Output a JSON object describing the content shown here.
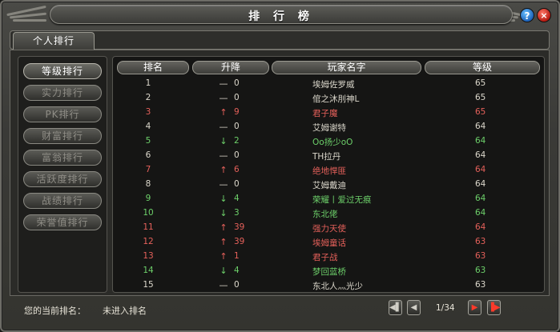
{
  "window": {
    "title": "排 行 榜",
    "help_label": "?",
    "close_label": "×"
  },
  "tab": {
    "label": "个人排行"
  },
  "sidebar": {
    "items": [
      {
        "label": "等级排行",
        "active": true
      },
      {
        "label": "实力排行",
        "active": false
      },
      {
        "label": "PK排行",
        "active": false
      },
      {
        "label": "财富排行",
        "active": false
      },
      {
        "label": "富翁排行",
        "active": false
      },
      {
        "label": "活跃度排行",
        "active": false
      },
      {
        "label": "战绩排行",
        "active": false
      },
      {
        "label": "荣誉值排行",
        "active": false
      }
    ]
  },
  "table": {
    "headers": {
      "rank": "排名",
      "change": "升降",
      "name": "玩家名字",
      "level": "等级"
    },
    "rows": [
      {
        "rank": "1",
        "dir": "flat",
        "delta": "0",
        "name": "埃姆佐罗威",
        "level": "65",
        "color": "white"
      },
      {
        "rank": "2",
        "dir": "flat",
        "delta": "0",
        "name": "倌之沐刖神L",
        "level": "65",
        "color": "white"
      },
      {
        "rank": "3",
        "dir": "up",
        "delta": "9",
        "name": "君子魔",
        "level": "65",
        "color": "red"
      },
      {
        "rank": "4",
        "dir": "flat",
        "delta": "0",
        "name": "艾姆谢特",
        "level": "64",
        "color": "white"
      },
      {
        "rank": "5",
        "dir": "down",
        "delta": "2",
        "name": "Oo扬少oO",
        "level": "64",
        "color": "green"
      },
      {
        "rank": "6",
        "dir": "flat",
        "delta": "0",
        "name": "TH拉丹",
        "level": "64",
        "color": "white"
      },
      {
        "rank": "7",
        "dir": "up",
        "delta": "6",
        "name": "绝地悍匪",
        "level": "64",
        "color": "red"
      },
      {
        "rank": "8",
        "dir": "flat",
        "delta": "0",
        "name": "艾姆戴迪",
        "level": "64",
        "color": "white"
      },
      {
        "rank": "9",
        "dir": "down",
        "delta": "4",
        "name": "荣耀丨爱过无痕",
        "level": "64",
        "color": "green"
      },
      {
        "rank": "10",
        "dir": "down",
        "delta": "3",
        "name": "东北佬",
        "level": "64",
        "color": "green"
      },
      {
        "rank": "11",
        "dir": "up",
        "delta": "39",
        "name": "强力天使",
        "level": "64",
        "color": "red"
      },
      {
        "rank": "12",
        "dir": "up",
        "delta": "39",
        "name": "埃姆童话",
        "level": "63",
        "color": "red"
      },
      {
        "rank": "13",
        "dir": "up",
        "delta": "1",
        "name": "君子战",
        "level": "63",
        "color": "red"
      },
      {
        "rank": "14",
        "dir": "down",
        "delta": "4",
        "name": "梦回蓝桥",
        "level": "63",
        "color": "green"
      },
      {
        "rank": "15",
        "dir": "flat",
        "delta": "0",
        "name": "东北人灬光少",
        "level": "63",
        "color": "white"
      }
    ]
  },
  "footer": {
    "current_rank_label": "您的当前排名：",
    "current_rank_value": "未进入排名",
    "page_indicator": "1/34"
  },
  "colors": {
    "red": "#e4605a",
    "green": "#6dd06a",
    "white": "#dcd8cc"
  }
}
